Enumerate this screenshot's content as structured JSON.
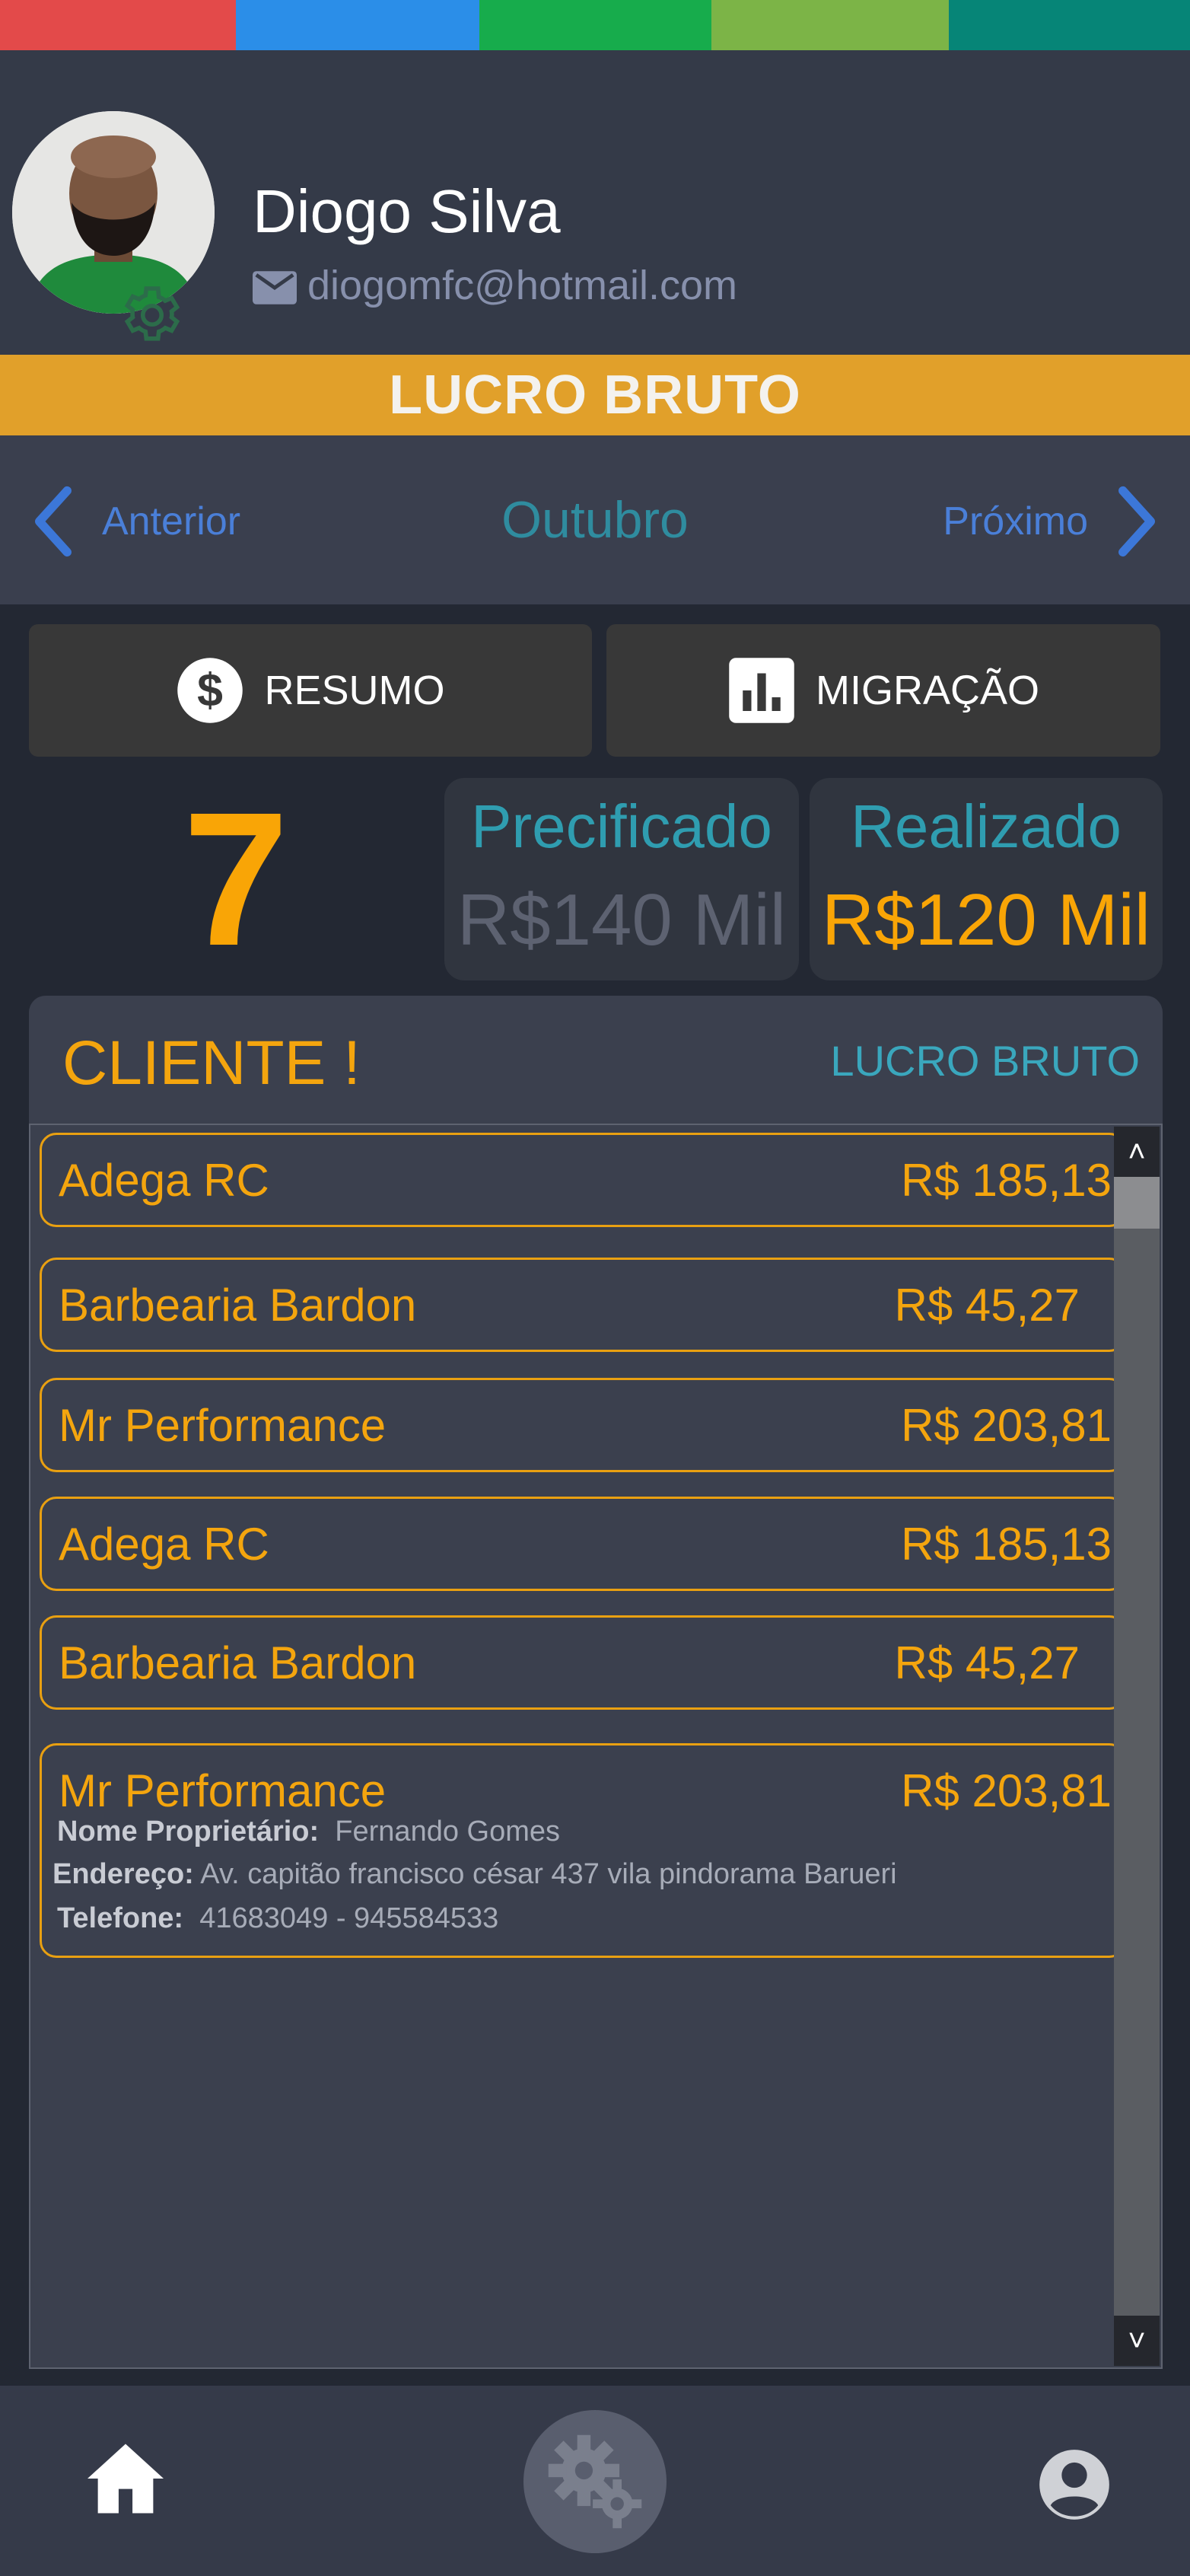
{
  "colors": {
    "strip": [
      "#e34a4a",
      "#2b8ee8",
      "#17ac4c",
      "#7cb447",
      "#068577"
    ],
    "accent": "#f9a506",
    "title_bar": "#e1a02a",
    "teal": "#2f9db0",
    "link_blue": "#4a7fd8"
  },
  "user": {
    "name": "Diogo Silva",
    "email": "diogomfc@hotmail.com",
    "avatar_icon": "user-photo",
    "settings_icon": "gear-icon",
    "mail_icon": "mail-icon"
  },
  "title": "LUCRO BRUTO",
  "month_nav": {
    "prev_label": "Anterior",
    "month": "Outubro",
    "next_label": "Próximo"
  },
  "tabs": {
    "resumo": {
      "label": "RESUMO",
      "icon": "dollar-icon"
    },
    "migracao": {
      "label": "MIGRAÇÃO",
      "icon": "bar-chart-icon"
    }
  },
  "stats": {
    "count": "7",
    "precificado": {
      "title": "Precificado",
      "value": "R$140 Mil"
    },
    "realizado": {
      "title": "Realizado",
      "value": "R$120 Mil"
    }
  },
  "panel": {
    "title": "CLIENTE !",
    "column_label": "LUCRO BRUTO"
  },
  "clients": [
    {
      "name": "Adega RC",
      "value": "R$ 185,13"
    },
    {
      "name": "Barbearia Bardon",
      "value": "R$ 45,27"
    },
    {
      "name": "Mr Performance",
      "value": "R$ 203,81"
    },
    {
      "name": "Adega RC",
      "value": "R$ 185,13"
    },
    {
      "name": "Barbearia Bardon",
      "value": "R$ 45,27"
    },
    {
      "name": "Mr Performance",
      "value": "R$ 203,81",
      "details": {
        "owner_label": "Nome Proprietário:",
        "owner": "Fernando Gomes",
        "address_label": "Endereço:",
        "address": "Av. capitão francisco césar 437 vila pindorama Barueri",
        "phone_label": "Telefone:",
        "phone": "41683049 -  945584533"
      }
    }
  ],
  "scrollbar": {
    "up": "˄",
    "down": "˅"
  },
  "bottom_nav": {
    "home_icon": "home-icon",
    "settings_icon": "gears-icon",
    "profile_icon": "account-circle-icon"
  }
}
